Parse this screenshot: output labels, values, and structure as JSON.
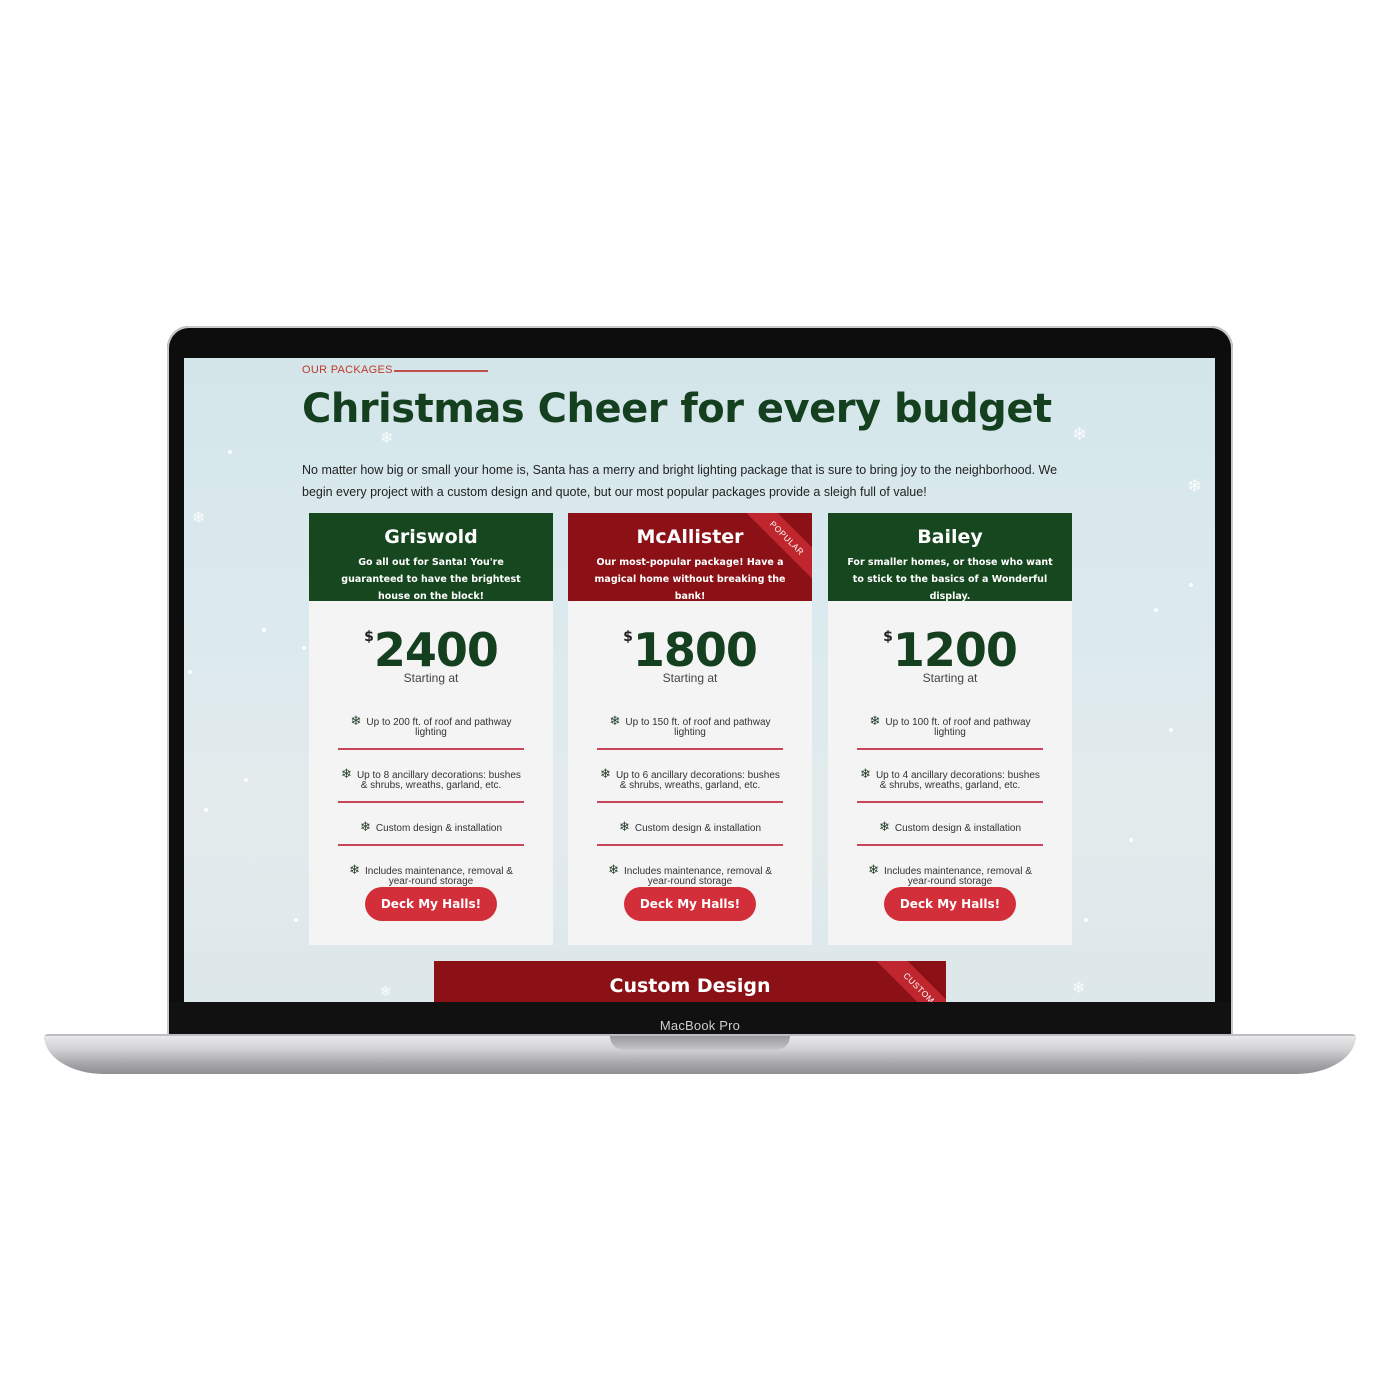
{
  "device": {
    "label": "MacBook Pro"
  },
  "section": {
    "eyebrow": "OUR PACKAGES",
    "title": "Christmas Cheer for every budget",
    "intro": "No matter how big or small your home is, Santa has a merry and bright lighting package that is sure to bring joy to the neighborhood. We begin every project with a custom design and quote, but our most popular packages provide a sleigh full of value!"
  },
  "colors": {
    "green": "#16471f",
    "red": "#8b1116",
    "button": "#d32f3a",
    "divider": "#c9455b"
  },
  "icons": {
    "feature": "snowflake-icon"
  },
  "packages": [
    {
      "name": "Griswold",
      "desc": "Go all out for Santa! You're guaranteed to have the brightest house on the block!",
      "currency": "$",
      "price": "2400",
      "price_note": "Starting at",
      "features": [
        "Up to 200 ft. of roof and pathway lighting",
        "Up to 8 ancillary decorations: bushes & shrubs, wreaths, garland, etc.",
        "Custom design & installation",
        "Includes maintenance, removal & year-round storage"
      ],
      "cta": "Deck My Halls!"
    },
    {
      "name": "McAllister",
      "badge": "POPULAR",
      "desc": "Our most-popular package! Have a magical home without breaking the bank!",
      "currency": "$",
      "price": "1800",
      "price_note": "Starting at",
      "features": [
        "Up to 150 ft. of roof and pathway lighting",
        "Up to 6 ancillary decorations: bushes & shrubs, wreaths, garland, etc.",
        "Custom design & installation",
        "Includes maintenance, removal & year-round storage"
      ],
      "cta": "Deck My Halls!"
    },
    {
      "name": "Bailey",
      "desc": "For smaller homes, or those who want to stick to the basics of a Wonderful display.",
      "currency": "$",
      "price": "1200",
      "price_note": "Starting at",
      "features": [
        "Up to 100 ft. of roof and pathway lighting",
        "Up to 4 ancillary decorations: bushes & shrubs, wreaths, garland, etc.",
        "Custom design & installation",
        "Includes maintenance, removal & year-round storage"
      ],
      "cta": "Deck My Halls!"
    }
  ],
  "custom": {
    "title": "Custom Design",
    "badge": "CUSTOM"
  }
}
